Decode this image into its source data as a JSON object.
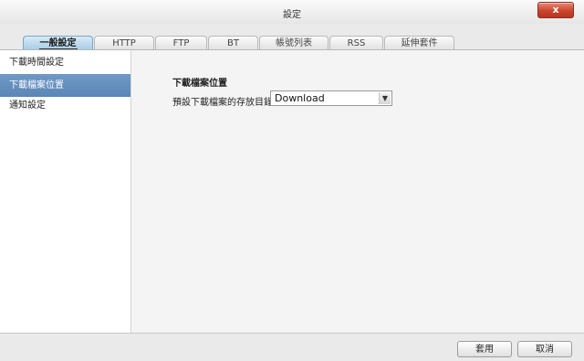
{
  "window": {
    "title": "設定",
    "close_label": "x"
  },
  "tabs": [
    {
      "label": "一般設定",
      "active": true
    },
    {
      "label": "HTTP"
    },
    {
      "label": "FTP"
    },
    {
      "label": "BT"
    },
    {
      "label": "帳號列表"
    },
    {
      "label": "RSS"
    },
    {
      "label": "延伸套件"
    }
  ],
  "sidebar": {
    "items": [
      {
        "label": "下載時間設定"
      },
      {
        "label": "下載檔案位置",
        "active": true
      },
      {
        "label": "通知設定"
      }
    ]
  },
  "main": {
    "section_title": "下載檔案位置",
    "field_label": "預設下載檔案的存放目錄",
    "folder_value": "Download"
  },
  "footer": {
    "apply_label": "套用",
    "cancel_label": "取消"
  },
  "colors": {
    "accent": "#5b86b6",
    "close": "#c9452e"
  }
}
